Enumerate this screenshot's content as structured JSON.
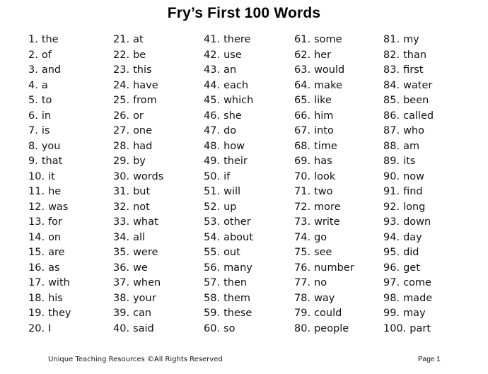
{
  "document": {
    "title": "Fry’s First 100 Words",
    "columns": [
      {
        "words": [
          {
            "num": "1.",
            "word": "the"
          },
          {
            "num": "2.",
            "word": "of"
          },
          {
            "num": "3.",
            "word": "and"
          },
          {
            "num": "4.",
            "word": "a"
          },
          {
            "num": "5.",
            "word": "to"
          },
          {
            "num": "6.",
            "word": "in"
          },
          {
            "num": "7.",
            "word": "is"
          },
          {
            "num": "8.",
            "word": "you"
          },
          {
            "num": "9.",
            "word": "that"
          },
          {
            "num": "10.",
            "word": "it"
          },
          {
            "num": "11.",
            "word": "he"
          },
          {
            "num": "12.",
            "word": "was"
          },
          {
            "num": "13.",
            "word": "for"
          },
          {
            "num": "14.",
            "word": "on"
          },
          {
            "num": "15.",
            "word": "are"
          },
          {
            "num": "16.",
            "word": "as"
          },
          {
            "num": "17.",
            "word": "with"
          },
          {
            "num": "18.",
            "word": "his"
          },
          {
            "num": "19.",
            "word": "they"
          },
          {
            "num": "20.",
            "word": "I"
          }
        ]
      },
      {
        "words": [
          {
            "num": "21.",
            "word": "at"
          },
          {
            "num": "22.",
            "word": "be"
          },
          {
            "num": "23.",
            "word": "this"
          },
          {
            "num": "24.",
            "word": "have"
          },
          {
            "num": "25.",
            "word": "from"
          },
          {
            "num": "26.",
            "word": "or"
          },
          {
            "num": "27.",
            "word": "one"
          },
          {
            "num": "28.",
            "word": "had"
          },
          {
            "num": "29.",
            "word": "by"
          },
          {
            "num": "30.",
            "word": "words"
          },
          {
            "num": "31.",
            "word": "but"
          },
          {
            "num": "32.",
            "word": "not"
          },
          {
            "num": "33.",
            "word": "what"
          },
          {
            "num": "34.",
            "word": "all"
          },
          {
            "num": "35.",
            "word": "were"
          },
          {
            "num": "36.",
            "word": "we"
          },
          {
            "num": "37.",
            "word": "when"
          },
          {
            "num": "38.",
            "word": "your"
          },
          {
            "num": "39.",
            "word": "can"
          },
          {
            "num": "40.",
            "word": "said"
          }
        ]
      },
      {
        "words": [
          {
            "num": "41.",
            "word": "there"
          },
          {
            "num": "42.",
            "word": "use"
          },
          {
            "num": "43.",
            "word": "an"
          },
          {
            "num": "44.",
            "word": "each"
          },
          {
            "num": "45.",
            "word": "which"
          },
          {
            "num": "46.",
            "word": "she"
          },
          {
            "num": "47.",
            "word": "do"
          },
          {
            "num": "48.",
            "word": "how"
          },
          {
            "num": "49.",
            "word": "their"
          },
          {
            "num": "50.",
            "word": "if"
          },
          {
            "num": "51.",
            "word": "will"
          },
          {
            "num": "52.",
            "word": "up"
          },
          {
            "num": "53.",
            "word": "other"
          },
          {
            "num": "54.",
            "word": "about"
          },
          {
            "num": "55.",
            "word": "out"
          },
          {
            "num": "56.",
            "word": "many"
          },
          {
            "num": "57.",
            "word": "then"
          },
          {
            "num": "58.",
            "word": "them"
          },
          {
            "num": "59.",
            "word": "these"
          },
          {
            "num": "60.",
            "word": "so"
          }
        ]
      },
      {
        "words": [
          {
            "num": "61.",
            "word": "some"
          },
          {
            "num": "62.",
            "word": "her"
          },
          {
            "num": "63.",
            "word": "would"
          },
          {
            "num": "64.",
            "word": "make"
          },
          {
            "num": "65.",
            "word": "like"
          },
          {
            "num": "66.",
            "word": "him"
          },
          {
            "num": "67.",
            "word": "into"
          },
          {
            "num": "68.",
            "word": "time"
          },
          {
            "num": "69.",
            "word": "has"
          },
          {
            "num": "70.",
            "word": "look"
          },
          {
            "num": "71.",
            "word": "two"
          },
          {
            "num": "72.",
            "word": "more"
          },
          {
            "num": "73.",
            "word": "write"
          },
          {
            "num": "74.",
            "word": "go"
          },
          {
            "num": "75.",
            "word": "see"
          },
          {
            "num": "76.",
            "word": "number"
          },
          {
            "num": "77.",
            "word": "no"
          },
          {
            "num": "78.",
            "word": "way"
          },
          {
            "num": "79.",
            "word": "could"
          },
          {
            "num": "80.",
            "word": "people"
          }
        ]
      },
      {
        "words": [
          {
            "num": "81.",
            "word": "my"
          },
          {
            "num": "82.",
            "word": "than"
          },
          {
            "num": "83.",
            "word": "first"
          },
          {
            "num": "84.",
            "word": "water"
          },
          {
            "num": "85.",
            "word": "been"
          },
          {
            "num": "86.",
            "word": "called"
          },
          {
            "num": "87.",
            "word": "who"
          },
          {
            "num": "88.",
            "word": "am"
          },
          {
            "num": "89.",
            "word": "its"
          },
          {
            "num": "90.",
            "word": "now"
          },
          {
            "num": "91.",
            "word": "find"
          },
          {
            "num": "92.",
            "word": "long"
          },
          {
            "num": "93.",
            "word": "down"
          },
          {
            "num": "94.",
            "word": "day"
          },
          {
            "num": "95.",
            "word": "did"
          },
          {
            "num": "96.",
            "word": "get"
          },
          {
            "num": "97.",
            "word": "come"
          },
          {
            "num": "98.",
            "word": "made"
          },
          {
            "num": "99.",
            "word": "may"
          },
          {
            "num": "100.",
            "word": "part"
          }
        ]
      }
    ],
    "footer": {
      "copyright": "Unique Teaching Resources ©All Rights Reserved",
      "page": "Page 1"
    }
  }
}
